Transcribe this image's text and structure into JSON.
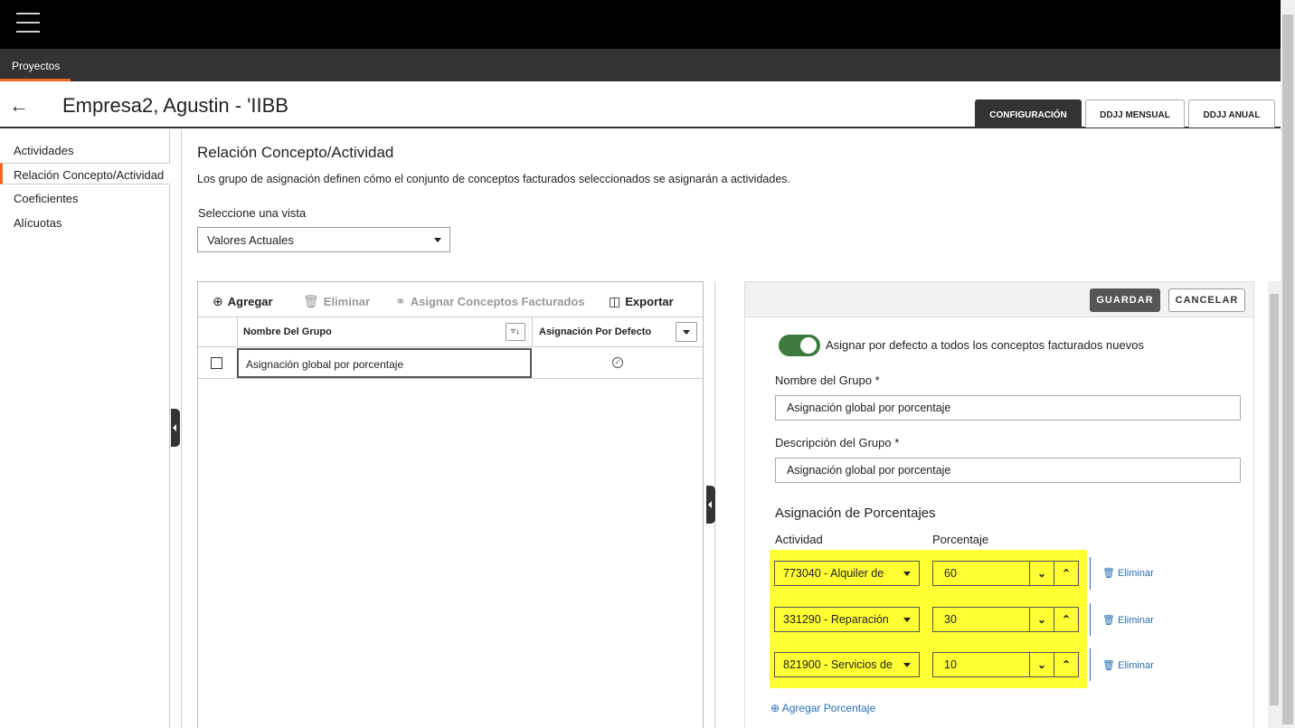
{
  "header": {
    "nav_item": "Proyectos",
    "page_title": "Empresa2, Agustin - 'IIBB",
    "tabs": [
      {
        "label": "CONFIGURACIÓN",
        "active": true
      },
      {
        "label": "DDJJ MENSUAL",
        "active": false
      },
      {
        "label": "DDJJ ANUAL",
        "active": false
      }
    ]
  },
  "sidebar": {
    "items": [
      {
        "label": "Actividades"
      },
      {
        "label": "Relación Concepto/Actividad"
      },
      {
        "label": "Coeficientes"
      },
      {
        "label": "Alícuotas"
      }
    ]
  },
  "main": {
    "title": "Relación Concepto/Actividad",
    "description": "Los grupo de asignación definen cómo el conjunto de conceptos facturados seleccionados se asignarán a actividades.",
    "view_label": "Seleccione una vista",
    "view_value": "Valores Actuales"
  },
  "grid": {
    "toolbar": {
      "add": "Agregar",
      "delete": "Eliminar",
      "assign": "Asignar Conceptos Facturados",
      "export": "Exportar"
    },
    "columns": [
      "Nombre Del Grupo",
      "Asignación Por Defecto"
    ],
    "rows": [
      {
        "name": "Asignación global por porcentaje",
        "default": true
      }
    ]
  },
  "panel": {
    "save": "GUARDAR",
    "cancel": "CANCELAR",
    "toggle_label": "Asignar por defecto a todos los conceptos facturados nuevos",
    "toggle_on": true,
    "name_label": "Nombre del Grupo",
    "name_value": "Asignación global por porcentaje",
    "desc_label": "Descripción del Grupo",
    "desc_value": "Asignación global por porcentaje",
    "required_mark": "*",
    "pct_title": "Asignación de Porcentajes",
    "col_activity": "Actividad",
    "col_pct": "Porcentaje",
    "rows": [
      {
        "activity": "773040 - Alquiler de",
        "pct": "60",
        "delete": "Eliminar"
      },
      {
        "activity": "331290 - Reparación",
        "pct": "30",
        "delete": "Eliminar"
      },
      {
        "activity": "821900 - Servicios de",
        "pct": "10",
        "delete": "Eliminar"
      }
    ],
    "add_link": "Agregar Porcentaje"
  },
  "colors": {
    "accent": "#f26522",
    "highlight": "#ffff33",
    "toggle": "#3d7a3d",
    "link": "#2a6fb5"
  }
}
